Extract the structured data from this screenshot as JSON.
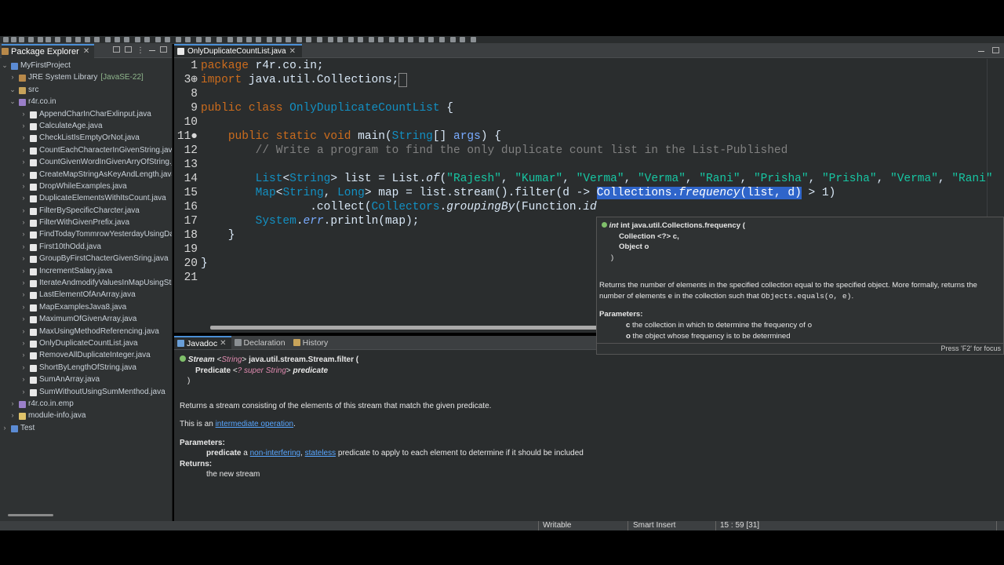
{
  "explorer": {
    "title": "Package Explorer",
    "items": [
      {
        "label": "MyFirstProject",
        "deco": "",
        "level": 0,
        "arrow": "⌄",
        "icon": "proj"
      },
      {
        "label": "JRE System Library",
        "deco": "[JavaSE-22]",
        "level": 1,
        "arrow": "›",
        "icon": "lib"
      },
      {
        "label": "src",
        "deco": "",
        "level": 1,
        "arrow": "⌄",
        "icon": "src"
      },
      {
        "label": "r4r.co.in",
        "deco": "",
        "level": 2,
        "arrow": "⌄",
        "icon": "pkg"
      },
      {
        "label": "AppendCharInCharExlinput.java",
        "deco": "",
        "level": 3,
        "arrow": "›",
        "icon": "java"
      },
      {
        "label": "CalculateAge.java",
        "deco": "",
        "level": 3,
        "arrow": "›",
        "icon": "java"
      },
      {
        "label": "CheckListIsEmptyOrNot.java",
        "deco": "",
        "level": 3,
        "arrow": "›",
        "icon": "java"
      },
      {
        "label": "CountEachCharacterInGivenString.java",
        "deco": "",
        "level": 3,
        "arrow": "›",
        "icon": "java"
      },
      {
        "label": "CountGivenWordInGivenArryOfString.java",
        "deco": "",
        "level": 3,
        "arrow": "›",
        "icon": "java"
      },
      {
        "label": "CreateMapStringAsKeyAndLength.java",
        "deco": "",
        "level": 3,
        "arrow": "›",
        "icon": "java"
      },
      {
        "label": "DropWhileExamples.java",
        "deco": "",
        "level": 3,
        "arrow": "›",
        "icon": "java"
      },
      {
        "label": "DuplicateElementsWithItsCount.java",
        "deco": "",
        "level": 3,
        "arrow": "›",
        "icon": "java"
      },
      {
        "label": "FilterBySpecificCharcter.java",
        "deco": "",
        "level": 3,
        "arrow": "›",
        "icon": "java"
      },
      {
        "label": "FilterWithGivenPrefix.java",
        "deco": "",
        "level": 3,
        "arrow": "›",
        "icon": "java"
      },
      {
        "label": "FindTodayTommrowYesterdayUsingDate.java",
        "deco": "",
        "level": 3,
        "arrow": "›",
        "icon": "java"
      },
      {
        "label": "First10thOdd.java",
        "deco": "",
        "level": 3,
        "arrow": "›",
        "icon": "java"
      },
      {
        "label": "GroupByFirstChacterGivenSring.java",
        "deco": "",
        "level": 3,
        "arrow": "›",
        "icon": "java"
      },
      {
        "label": "IncrementSalary.java",
        "deco": "",
        "level": 3,
        "arrow": "›",
        "icon": "java"
      },
      {
        "label": "IterateAndmodifyValuesInMapUsingStream.java",
        "deco": "",
        "level": 3,
        "arrow": "›",
        "icon": "java"
      },
      {
        "label": "LastElementOfAnArray.java",
        "deco": "",
        "level": 3,
        "arrow": "›",
        "icon": "java"
      },
      {
        "label": "MapExamplesJava8.java",
        "deco": "",
        "level": 3,
        "arrow": "›",
        "icon": "java"
      },
      {
        "label": "MaximumOfGivenArray.java",
        "deco": "",
        "level": 3,
        "arrow": "›",
        "icon": "java"
      },
      {
        "label": "MaxUsingMethodReferencing.java",
        "deco": "",
        "level": 3,
        "arrow": "›",
        "icon": "java"
      },
      {
        "label": "OnlyDuplicateCountList.java",
        "deco": "",
        "level": 3,
        "arrow": "›",
        "icon": "java"
      },
      {
        "label": "RemoveAllDuplicateInteger.java",
        "deco": "",
        "level": 3,
        "arrow": "›",
        "icon": "java"
      },
      {
        "label": "ShortByLengthOfString.java",
        "deco": "",
        "level": 3,
        "arrow": "›",
        "icon": "java"
      },
      {
        "label": "SumAnArray.java",
        "deco": "",
        "level": 3,
        "arrow": "›",
        "icon": "java"
      },
      {
        "label": "SumWithoutUsingSumMenthod.java",
        "deco": "",
        "level": 3,
        "arrow": "›",
        "icon": "java"
      },
      {
        "label": "r4r.co.in.emp",
        "deco": "",
        "level": 2,
        "arrow": "›",
        "icon": "pkg"
      },
      {
        "label": "module-info.java",
        "deco": "",
        "level": 2,
        "arrow": "›",
        "icon": "mod"
      },
      {
        "label": "Test",
        "deco": "",
        "level": 0,
        "arrow": "›",
        "icon": "proj"
      }
    ]
  },
  "editor": {
    "tab_label": "OnlyDuplicateCountList.java",
    "lines": [
      {
        "num": "1",
        "code": "<span class=\"kw\">package</span> r4r.co.in;"
      },
      {
        "num": "3⊕",
        "code": "<span class=\"kw\">import</span> java.util.Collections;<span style=\"border:1px solid #888;\">&nbsp;</span>"
      },
      {
        "num": "8",
        "code": ""
      },
      {
        "num": "9",
        "code": "<span class=\"kw\">public class</span> <span class=\"ty\">OnlyDuplicateCountList</span> {"
      },
      {
        "num": "10",
        "code": ""
      },
      {
        "num": "11●",
        "code": "    <span class=\"kw\">public static void</span> main(<span class=\"ty\">String</span>[] <span class=\"vr\">args</span>) {"
      },
      {
        "num": "12",
        "code": "        <span class=\"cm\">// Write a program to find the only duplicate count list in the List-Published</span>"
      },
      {
        "num": "13",
        "code": ""
      },
      {
        "num": "14",
        "code": "        <span class=\"ty\">List</span>&lt;<span class=\"ty\">String</span>&gt; list = List.<span class=\"it\">of</span>(<span class=\"str\">\"Rajesh\"</span>, <span class=\"str\">\"Kumar\"</span>, <span class=\"str\">\"Verma\"</span>, <span class=\"str\">\"Verma\"</span>, <span class=\"str\">\"Rani\"</span>, <span class=\"str\">\"Prisha\"</span>, <span class=\"str\">\"Prisha\"</span>, <span class=\"str\">\"Verma\"</span>, <span class=\"str\">\"Rani\"</span>"
      },
      {
        "num": "15",
        "code": "        <span class=\"ty\">Map</span>&lt;<span class=\"ty\">String</span>, <span class=\"ty\">Long</span>&gt; map = list.stream().filter(d -&gt; <span class=\"sel\">Collections.<span class=\"it\">frequency</span>(list, d)</span> &gt; 1)"
      },
      {
        "num": "16",
        "code": "                .collect(<span class=\"ty\">Collectors</span>.<span class=\"it\">groupingBy</span>(Function.<span class=\"it\">id</span>"
      },
      {
        "num": "17",
        "code": "        <span class=\"ty\">System</span>.<span class=\"vr it\">err</span>.println(map);"
      },
      {
        "num": "18",
        "code": "    }"
      },
      {
        "num": "19",
        "code": ""
      },
      {
        "num": "20",
        "code": "}"
      },
      {
        "num": "21",
        "code": ""
      }
    ]
  },
  "popup": {
    "sig_line1": "int java.util.Collections.frequency (",
    "sig_line2": "Collection <?> c,",
    "sig_line3": "Object o",
    "sig_line4": ")",
    "desc_a": "Returns the number of elements in the specified collection equal to the specified object. More formally, returns the number of elements ",
    "desc_e": "e",
    "desc_b": " in the collection such that ",
    "desc_code": "Objects.equals(o, e)",
    "desc_end": ".",
    "params_title": "Parameters:",
    "param_c_name": "c",
    "param_c_desc": " the collection in which to determine the frequency of ",
    "param_c_code": "o",
    "param_o_name": "o",
    "param_o_desc": " the object whose frequency is to be determined",
    "footer": "Press 'F2' for focus"
  },
  "javadoc": {
    "tabs": [
      "Javadoc",
      "Declaration",
      "History"
    ],
    "sig_type": "Stream",
    "sig_generic": "String",
    "sig_method": "java.util.stream.Stream.filter (",
    "sig_param_type": "Predicate",
    "sig_param_generic": "? super String",
    "sig_param_name": "predicate",
    "sig_close": ")",
    "desc": "Returns a stream consisting of the elements of this stream that match the given predicate.",
    "this_is": "This is an ",
    "intermediate_link": "intermediate operation",
    "period": ".",
    "params_title": "Parameters:",
    "param_name": "predicate",
    "param_a": " a ",
    "non_interfering": "non-interfering",
    "comma": ", ",
    "stateless": "stateless",
    "param_rest": " predicate to apply to each element to determine if it should be included",
    "returns_title": "Returns:",
    "returns_desc": "the new stream"
  },
  "status": {
    "writable": "Writable",
    "insert_mode": "Smart Insert",
    "position": "15 : 59 [31]"
  }
}
